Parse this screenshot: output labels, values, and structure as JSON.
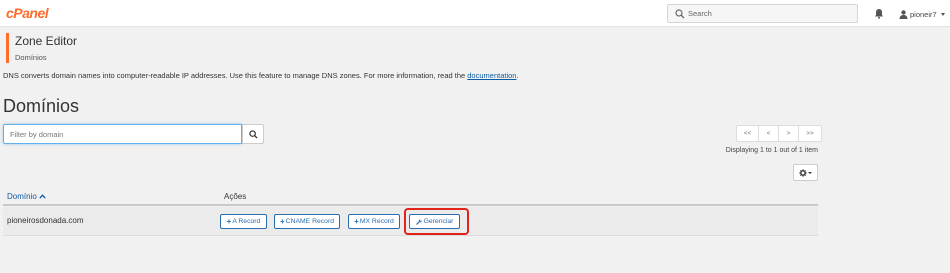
{
  "header": {
    "logo_text": "cPanel",
    "search_placeholder": "Search",
    "username": "pioneir7"
  },
  "page": {
    "title": "Zone Editor",
    "breadcrumb": "Domínios",
    "intro_text": "DNS converts domain names into computer-readable IP addresses. Use this feature to manage DNS zones. For more information, read the ",
    "intro_link": "documentation",
    "intro_end": "."
  },
  "section": {
    "title": "Domínios",
    "filter_placeholder": "Filter by domain"
  },
  "pagination": {
    "first": "<<",
    "prev": "<",
    "next": ">",
    "last": ">>",
    "display_text": "Displaying 1 to 1 out of 1 item"
  },
  "table": {
    "col_domain": "Domínio",
    "col_actions": "Ações",
    "rows": [
      {
        "domain": "pioneirosdonada.com",
        "a_record": "A Record",
        "cname_record": "CNAME Record",
        "mx_record": "MX Record",
        "manage": "Gerenciar"
      }
    ]
  },
  "colors": {
    "brand_orange": "#ff6c2c",
    "link_blue": "#0c5ca5",
    "highlight_red": "#e2231a"
  },
  "icons": [
    "search-icon",
    "bell-icon",
    "user-icon",
    "gear-icon",
    "wrench-icon",
    "sort-up-icon"
  ]
}
